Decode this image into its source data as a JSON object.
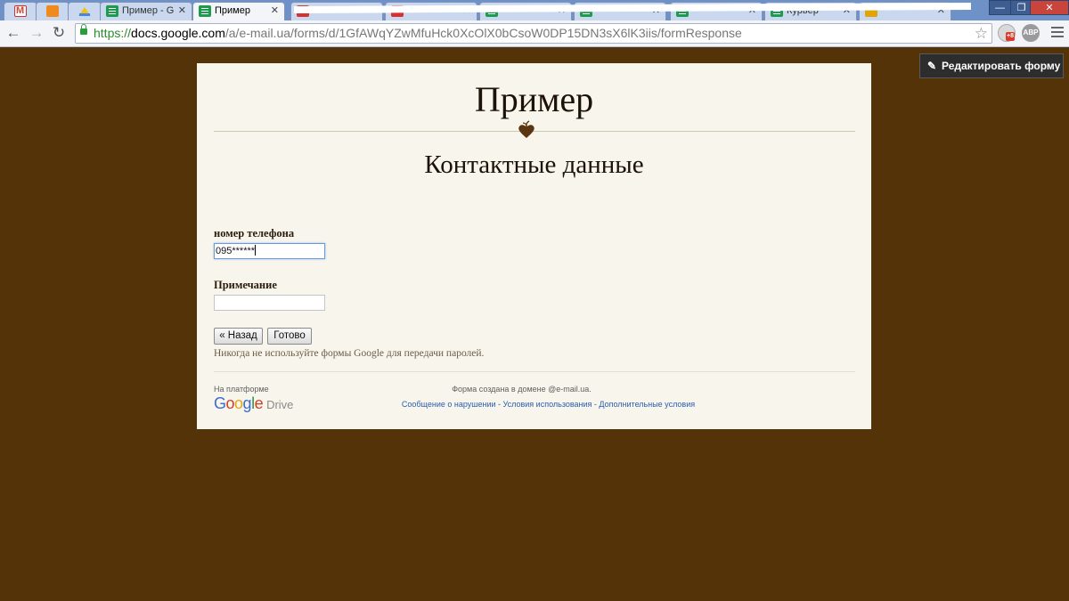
{
  "browser": {
    "tabs": [
      {
        "title": "",
        "icon": "gmail-icon",
        "pinned": true
      },
      {
        "title": "",
        "icon": "orange-app-icon",
        "pinned": true
      },
      {
        "title": "",
        "icon": "drive-icon",
        "pinned": true
      },
      {
        "title": "Пример - G",
        "icon": "sheets-icon"
      },
      {
        "title": "Пример",
        "icon": "sheets-icon",
        "active": true
      },
      {
        "title": "",
        "icon": "red-app-icon"
      },
      {
        "title": "",
        "icon": "red-app-icon"
      },
      {
        "title": "",
        "icon": "sheets-icon"
      },
      {
        "title": "",
        "icon": "sheets-icon"
      },
      {
        "title": "",
        "icon": "sheets-icon"
      },
      {
        "title": "Курьер",
        "icon": "sheets-icon"
      },
      {
        "title": "",
        "icon": "mixed-app-icon"
      }
    ],
    "window_controls": {
      "minimize": "—",
      "maximize": "❐",
      "close": "✕"
    },
    "url": {
      "scheme": "https://",
      "host": "docs.google.com",
      "path": "/a/e-mail.ua/forms/d/1GfAWqYZwMfuHck0XcOlX0bCsoW0DP15DN3sX6lK3iis/formResponse"
    },
    "extensions": {
      "badge": "+8",
      "abp": "ABP"
    }
  },
  "page": {
    "edit_button": "Редактировать форму",
    "form_title": "Пример",
    "section_title": "Контактные данные",
    "questions": [
      {
        "label": "номер телефона",
        "value": "095******",
        "focused": true
      },
      {
        "label": "Примечание",
        "value": ""
      }
    ],
    "back_button": "« Назад",
    "submit_button": "Готово",
    "password_warning": "Никогда не используйте формы Google для передачи паролей.",
    "footer": {
      "powered_by": "На платформе",
      "logo_word": "Google",
      "logo_product": "Drive",
      "domain_note": "Форма создана в домене @e-mail.ua.",
      "links": [
        "Сообщение о нарушении",
        "Условия использования",
        "Дополнительные условия"
      ],
      "separator": " - "
    }
  },
  "colors": {
    "page_background": "#543309",
    "form_background": "#f8f5ec",
    "tabstrip": "#6e92c8",
    "link": "#2a5db0"
  }
}
